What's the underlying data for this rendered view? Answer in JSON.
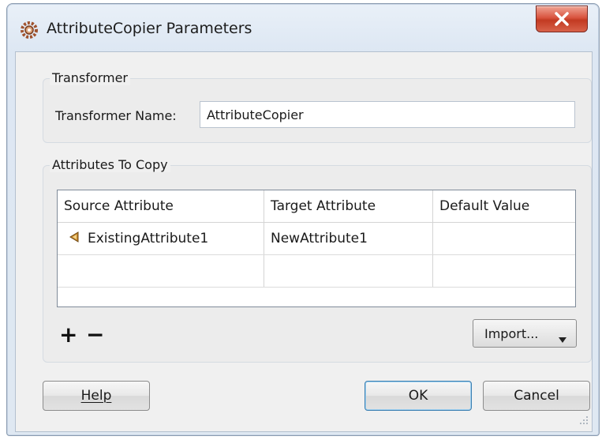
{
  "window": {
    "title": "AttributeCopier Parameters",
    "close_glyph": "✕"
  },
  "transformer_group": {
    "label": "Transformer",
    "name_label": "Transformer Name:",
    "name_value": "AttributeCopier"
  },
  "attributes_group": {
    "label": "Attributes To Copy",
    "columns": [
      "Source Attribute",
      "Target Attribute",
      "Default Value"
    ],
    "rows": [
      {
        "source": "ExistingAttribute1",
        "target": "NewAttribute1",
        "default": "",
        "source_icon": "attribute-icon"
      },
      {
        "source": "",
        "target": "",
        "default": ""
      }
    ],
    "add_label": "+",
    "remove_label": "−",
    "import_label": "Import..."
  },
  "buttons": {
    "help": "Help",
    "ok": "OK",
    "cancel": "Cancel"
  },
  "colors": {
    "close_red": "#c23a22",
    "window_frame": "#dde7f3",
    "ok_focus": "#3c7fb1"
  }
}
